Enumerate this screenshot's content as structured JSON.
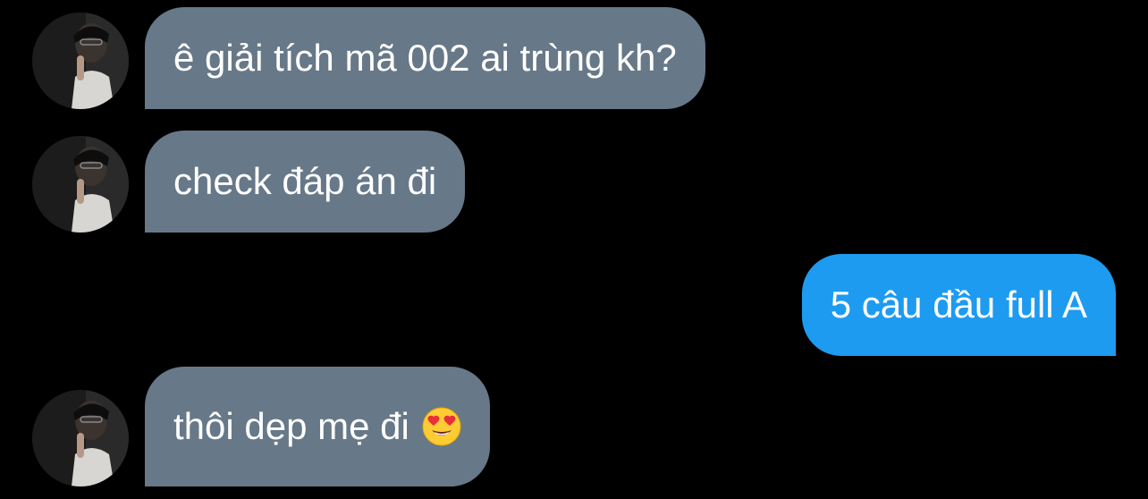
{
  "colors": {
    "background": "#000000",
    "incoming_bubble": "#677888",
    "outgoing_bubble": "#1d9bf0",
    "text": "#ffffff"
  },
  "messages": [
    {
      "direction": "incoming",
      "text": "ê giải tích mã 002 ai trùng kh?",
      "avatar": "profile-avatar"
    },
    {
      "direction": "incoming",
      "text": "check đáp án đi",
      "avatar": "profile-avatar"
    },
    {
      "direction": "outgoing",
      "text": "5 câu đầu full A"
    },
    {
      "direction": "incoming",
      "text": "thôi dẹp mẹ đi",
      "emoji": "heart-eyes-emoji",
      "avatar": "profile-avatar"
    }
  ]
}
